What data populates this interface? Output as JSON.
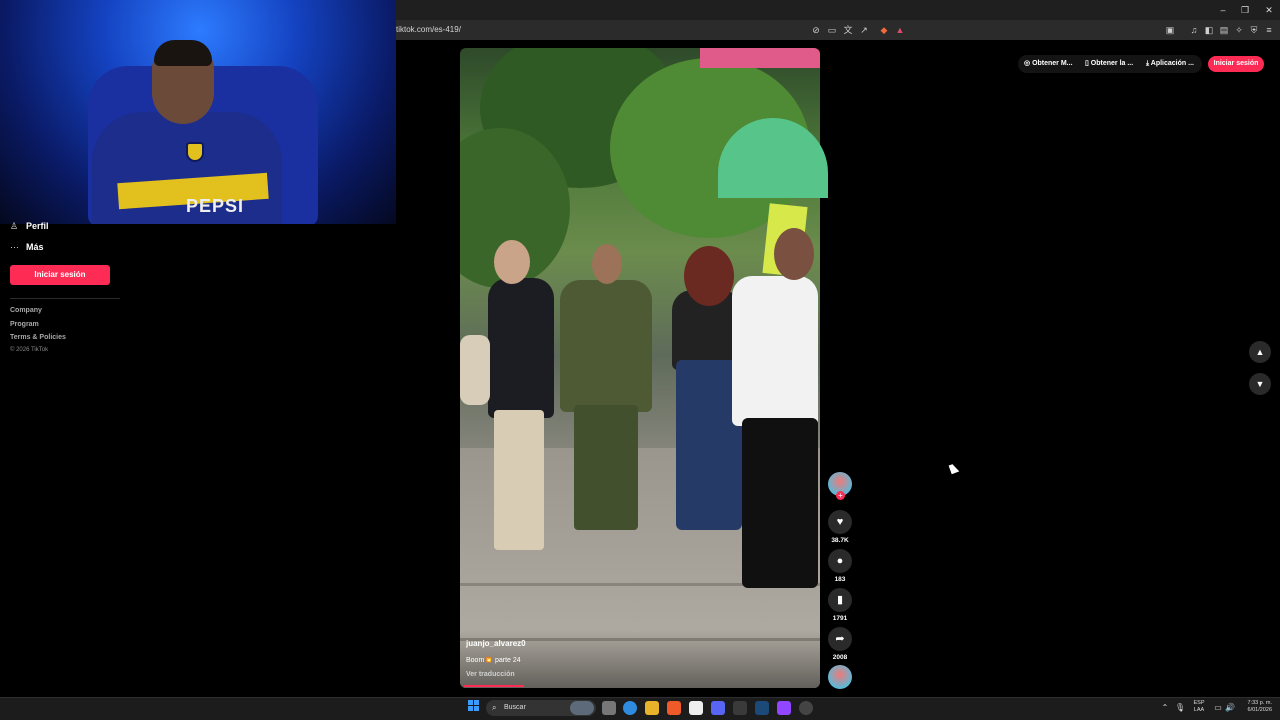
{
  "browser": {
    "url": "tiktok.com/es-419/",
    "window_controls": [
      "–",
      "❐",
      "✕"
    ]
  },
  "sidebar": {
    "items": [
      {
        "label": "Perfil",
        "icon": "person-icon"
      },
      {
        "label": "Más",
        "icon": "more-icon"
      }
    ],
    "login_label": "Iniciar sesión",
    "footer_links": [
      "Company",
      "Program",
      "Terms & Policies"
    ],
    "copyright": "© 2026 TikTok"
  },
  "video": {
    "author": "juanjo_alvarez0",
    "caption": "Boom💥 parte 24",
    "translate_label": "Ver traducción",
    "progress_fraction": 0.17
  },
  "actions": {
    "likes": "38.7K",
    "comments": "183",
    "saves": "1791",
    "shares": "2008"
  },
  "topbar": {
    "get_m": "Obtener M...",
    "get_app": "Obtener la ...",
    "app": "Aplicación ...",
    "login_label": "Iniciar sesión"
  },
  "taskbar": {
    "search_placeholder": "Buscar",
    "lang_line1": "ESP",
    "lang_line2": "LAA",
    "time": "7:33 p. m.",
    "date": "6/01/2026"
  },
  "colors": {
    "brand": "#fe2c55",
    "background": "#000000"
  }
}
